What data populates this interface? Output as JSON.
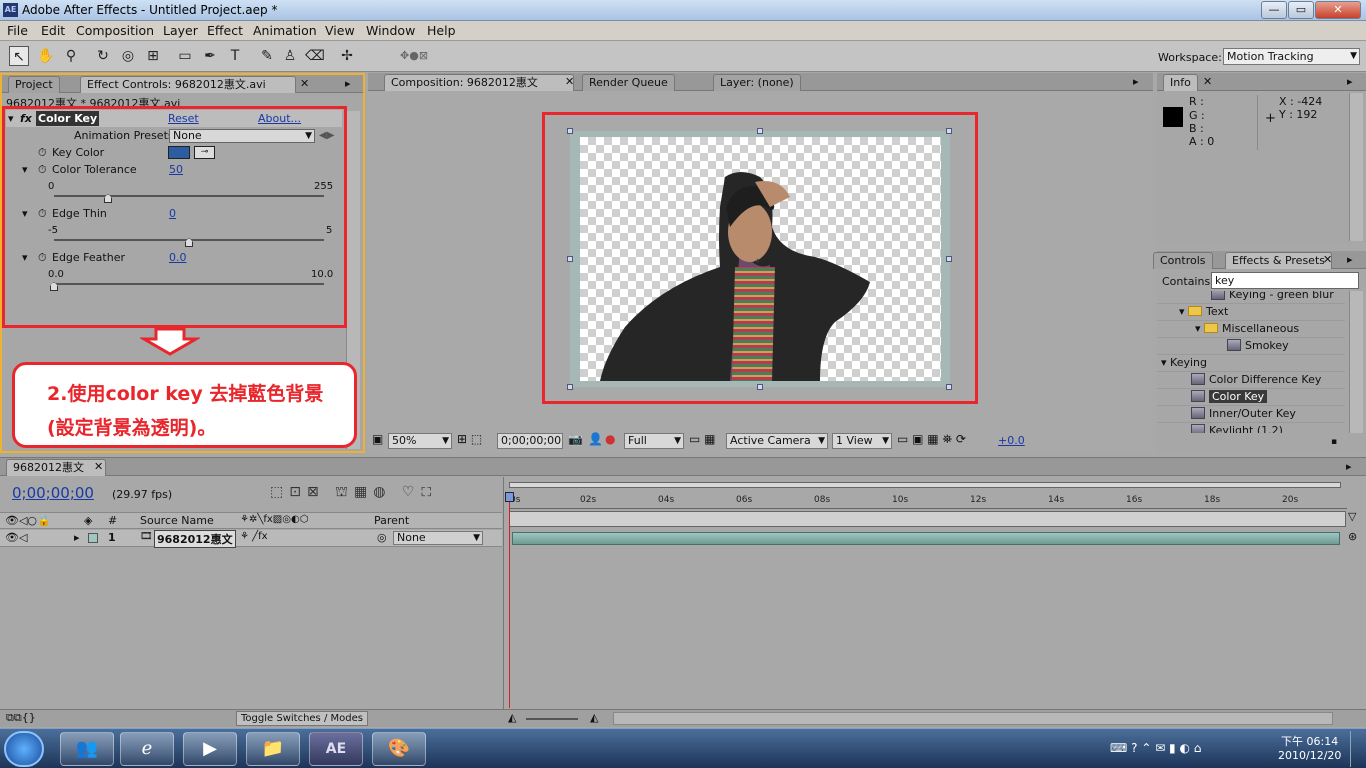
{
  "window": {
    "title": "Adobe After Effects - Untitled Project.aep *",
    "app_abbr": "AE",
    "minimize": "—",
    "maximize": "▭",
    "close": "✕"
  },
  "menu": [
    "File",
    "Edit",
    "Composition",
    "Layer",
    "Effect",
    "Animation",
    "View",
    "Window",
    "Help"
  ],
  "workspace": {
    "label": "Workspace:",
    "value": "Motion Tracking"
  },
  "left_panel": {
    "tabs": {
      "project": "Project",
      "effect_controls": "Effect Controls: 9682012惠文.avi"
    },
    "path": "9682012惠文 * 9682012惠文.avi",
    "effect": {
      "name": "Color Key",
      "reset": "Reset",
      "about": "About...",
      "presets_label": "Animation Presets:",
      "presets_value": "None"
    },
    "props": {
      "key_color": {
        "label": "Key Color",
        "color": "#2b5da0"
      },
      "tolerance": {
        "label": "Color Tolerance",
        "value": "50",
        "min": "0",
        "max": "255",
        "level": 0.2
      },
      "edge_thin": {
        "label": "Edge Thin",
        "value": "0",
        "min": "-5",
        "max": "5",
        "level": 0.5
      },
      "edge_feather": {
        "label": "Edge Feather",
        "value": "0.0",
        "min": "0.0",
        "max": "10.0",
        "level": 0.0
      }
    },
    "callout_line1": "2.使用color key 去掉藍色背景",
    "callout_line2": "(設定背景為透明)。"
  },
  "comp_panel": {
    "tabs": {
      "composition": "Composition: 9682012惠文",
      "render_queue": "Render Queue",
      "layer": "Layer: (none)"
    },
    "controls": {
      "zoom": "50%",
      "timecode": "0;00;00;00",
      "resolution": "Full",
      "camera": "Active Camera",
      "view": "1 View",
      "exposure": "+0.0"
    }
  },
  "info_panel": {
    "tab": "Info",
    "r": "R :",
    "g": "G :",
    "b": "B :",
    "a": "A : 0",
    "x": "X : -424",
    "y": "Y : 192"
  },
  "effects_panel": {
    "tab_controls": "Controls",
    "tab_presets": "Effects & Presets",
    "contains_label": "Contains:",
    "search": "key",
    "items": [
      "Keying - green blur",
      "Text",
      "Miscellaneous",
      "Smokey",
      "Keying",
      "Color Difference Key",
      "Color Key",
      "Inner/Outer Key",
      "Keylight (1.2)"
    ]
  },
  "timeline": {
    "tab": "9682012惠文",
    "timecode": "0;00;00;00",
    "fps": "(29.97 fps)",
    "col_num": "#",
    "col_source": "Source Name",
    "col_parent": "Parent",
    "layer_num": "1",
    "layer_name": "9682012惠文",
    "layer_parent": "None",
    "ticks": [
      "0s",
      "02s",
      "04s",
      "06s",
      "08s",
      "10s",
      "12s",
      "14s",
      "16s",
      "18s",
      "20s"
    ],
    "toggle": "Toggle Switches / Modes"
  },
  "taskbar": {
    "time": "下午 06:14",
    "date": "2010/12/20",
    "ae": "AE"
  }
}
